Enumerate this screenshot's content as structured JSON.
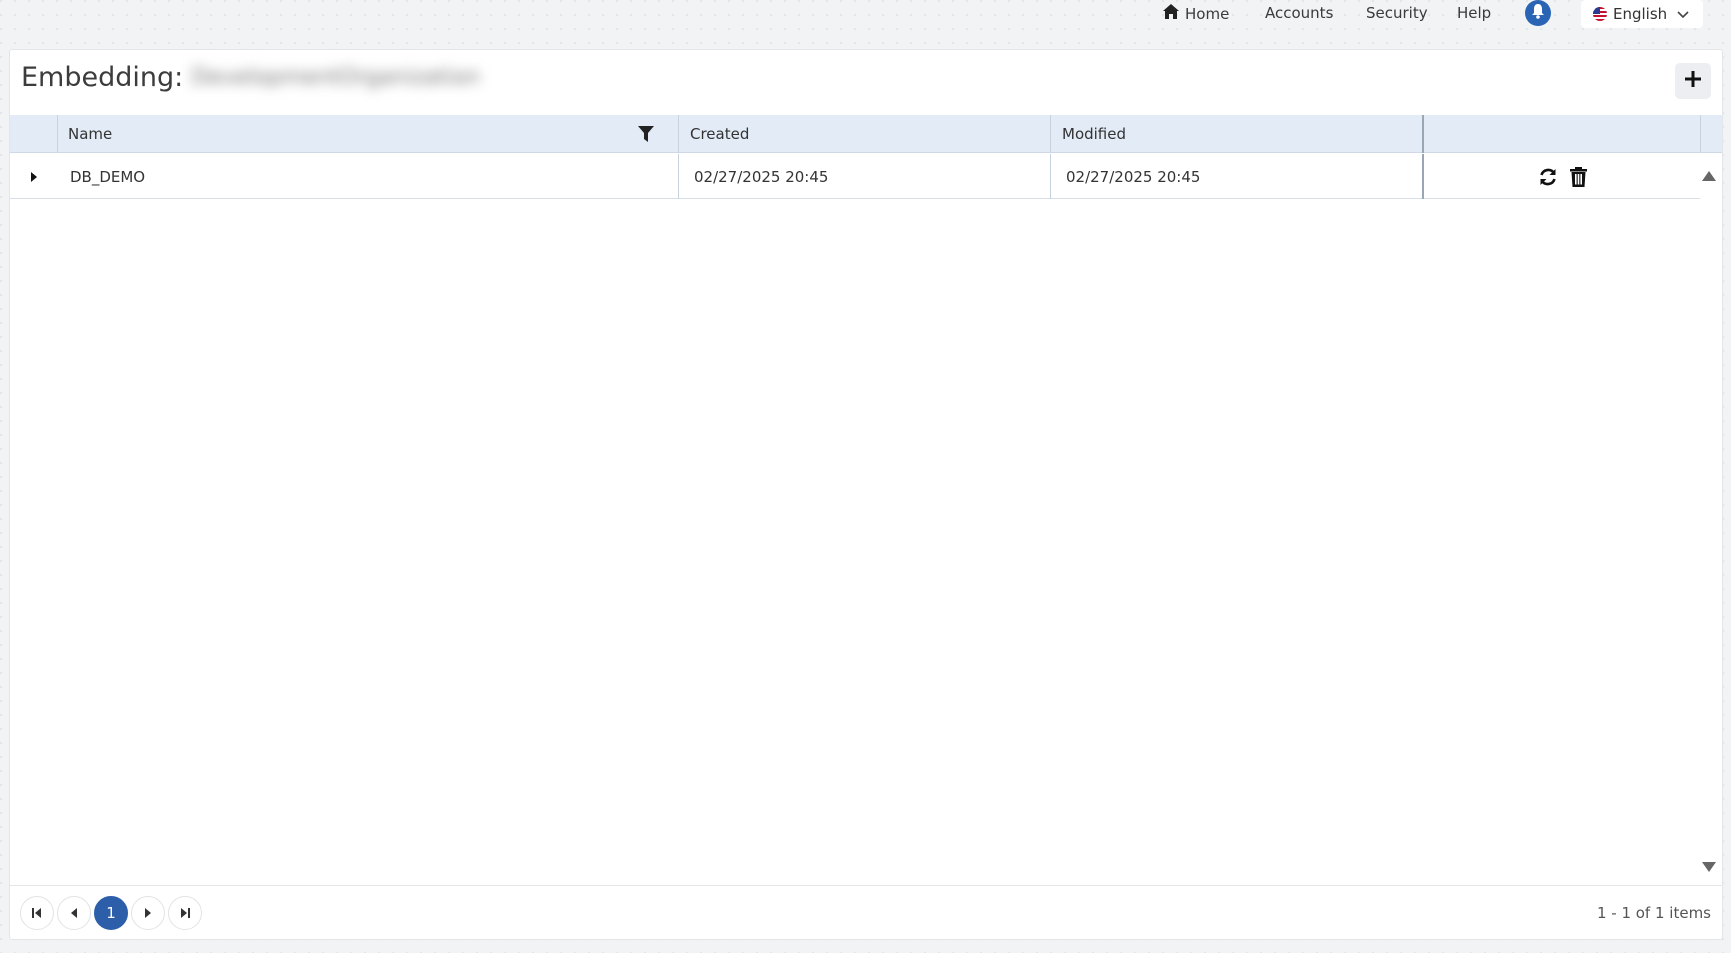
{
  "nav": {
    "home": "Home",
    "accounts": "Accounts",
    "security": "Security",
    "help": "Help",
    "language": "English"
  },
  "panel": {
    "title": "Embedding:",
    "subtitle_blurred": "DevelopmentOrganization"
  },
  "grid": {
    "columns": [
      "Name",
      "Created",
      "Modified"
    ],
    "rows": [
      {
        "name": "DB_DEMO",
        "created": "02/27/2025 20:45",
        "modified": "02/27/2025 20:45"
      }
    ]
  },
  "pager": {
    "current_page": "1",
    "info": "1 - 1 of 1 items"
  },
  "colors": {
    "accent": "#2d5ea9",
    "header_bg": "#e2ebf6",
    "bell": "#2a64b5"
  }
}
